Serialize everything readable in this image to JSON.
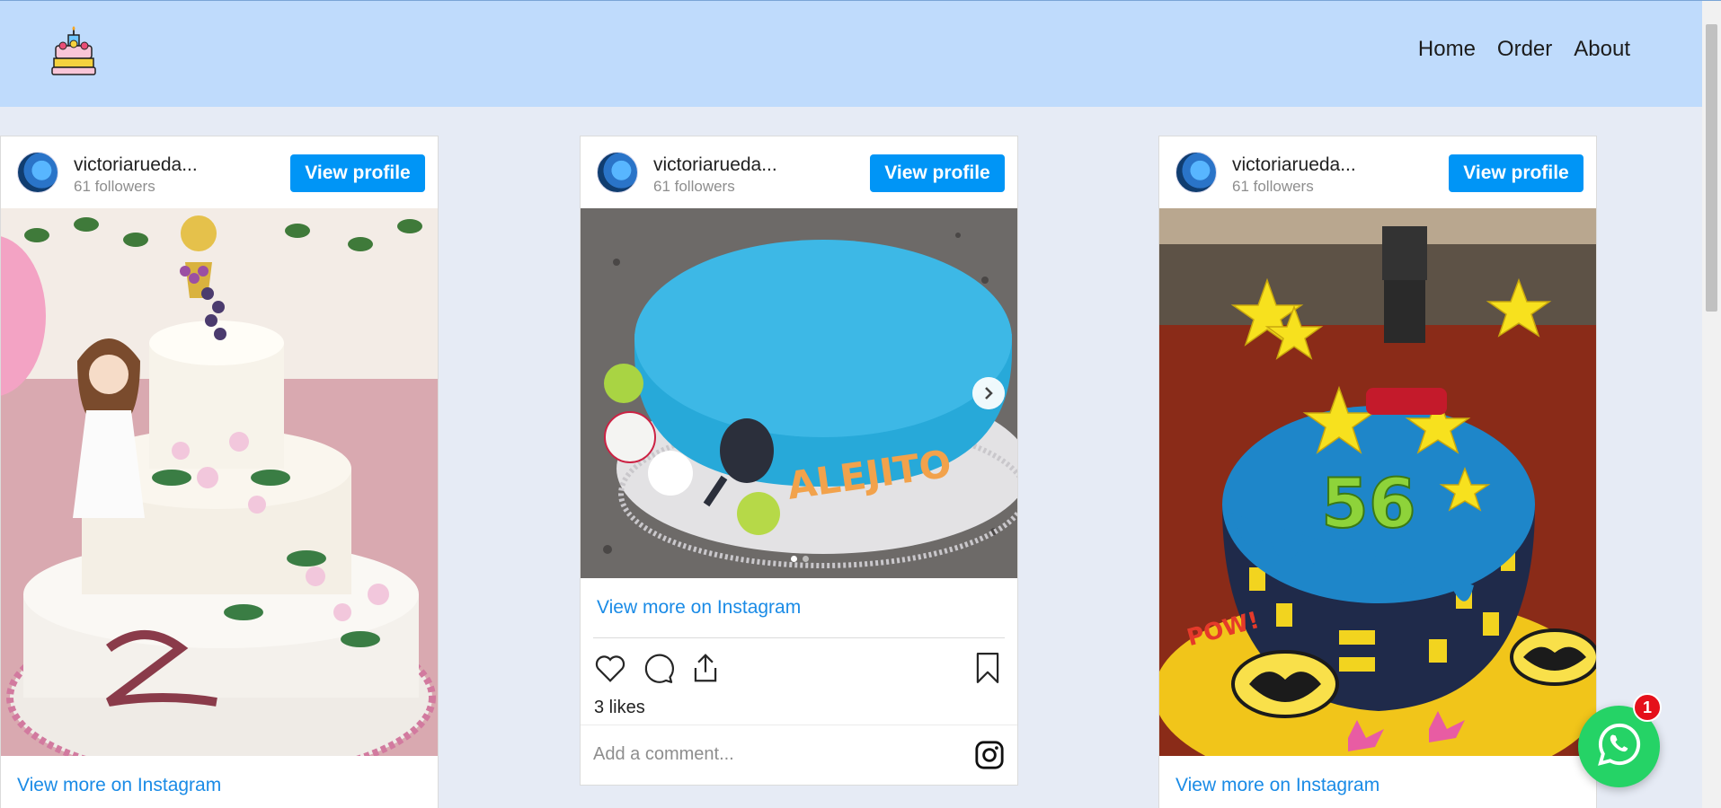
{
  "nav": {
    "logo_icon": "cake-icon",
    "links": [
      "Home",
      "Order",
      "About"
    ]
  },
  "posts": [
    {
      "username": "victoriarueda...",
      "followers": "61 followers",
      "view_profile": "View profile",
      "view_more": "View more on Instagram",
      "photo": "Three-tier white communion cake with girl figurine, chalice and flowers"
    },
    {
      "username": "victoriarueda...",
      "followers": "61 followers",
      "view_profile": "View profile",
      "view_more": "View more on Instagram",
      "photo": "Blue fondant sports cake with tennis balls and racket",
      "likes": "3 likes",
      "comment_placeholder": "Add a comment...",
      "carousel": {
        "total": 2,
        "active": 1
      }
    },
    {
      "username": "victoriarueda...",
      "followers": "61 followers",
      "view_profile": "View profile",
      "view_more": "View more on Instagram",
      "photo": "Batman themed cake with LEGO figure, stars and number 56"
    }
  ],
  "whatsapp": {
    "icon": "whatsapp-icon",
    "badge": "1"
  },
  "colors": {
    "navbar": "#bfdbfc",
    "background": "#e6ebf5",
    "accent": "#0095f6",
    "link": "#1a8be6",
    "whatsapp": "#25d366",
    "badge": "#e5101b"
  }
}
